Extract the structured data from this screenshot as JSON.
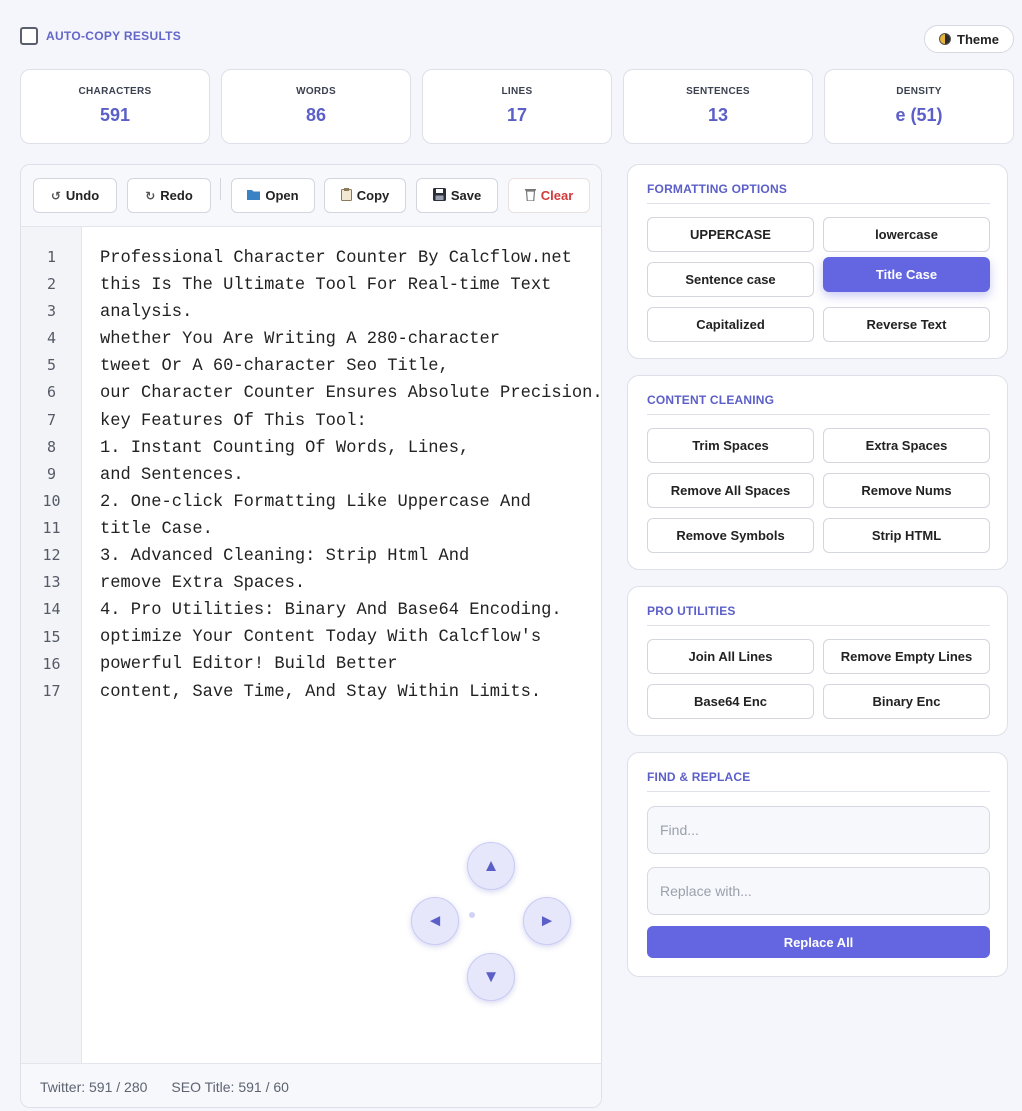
{
  "topbar": {
    "autocopy_label": "AUTO-COPY RESULTS",
    "autocopy_checked": false,
    "theme_label": "Theme"
  },
  "stats": [
    {
      "label": "CHARACTERS",
      "value": "591"
    },
    {
      "label": "WORDS",
      "value": "86"
    },
    {
      "label": "LINES",
      "value": "17"
    },
    {
      "label": "SENTENCES",
      "value": "13"
    },
    {
      "label": "DENSITY",
      "value": "e (51)"
    }
  ],
  "toolbar": {
    "undo": "Undo",
    "redo": "Redo",
    "open": "Open",
    "copy": "Copy",
    "save": "Save",
    "clear": "Clear"
  },
  "editor": {
    "line_numbers": [
      "1",
      "2",
      "3",
      "4",
      "5",
      "6",
      "7",
      "8",
      "9",
      "10",
      "11",
      "12",
      "13",
      "14",
      "15",
      "16",
      "17"
    ],
    "lines": [
      "Professional Character Counter By Calcflow.net",
      "this Is The Ultimate Tool For Real-time Text",
      "analysis.",
      "whether You Are Writing A 280-character",
      "tweet Or A 60-character Seo Title,",
      "our Character Counter Ensures Absolute Precision.",
      "key Features Of This Tool:",
      "1. Instant Counting Of Words, Lines,",
      "and Sentences.",
      "2. One-click Formatting Like Uppercase And",
      "title Case.",
      "3. Advanced Cleaning: Strip Html And",
      "remove Extra Spaces.",
      "4. Pro Utilities: Binary And Base64 Encoding.",
      "optimize Your Content Today With Calcflow's",
      "powerful Editor! Build Better",
      "content, Save Time, And Stay Within Limits."
    ]
  },
  "footer": {
    "twitter": "Twitter: 591 / 280",
    "seo": "SEO Title: 591 / 60"
  },
  "formatting": {
    "title": "FORMATTING OPTIONS",
    "buttons": [
      "UPPERCASE",
      "lowercase",
      "Sentence case",
      "Title Case",
      "Capitalized",
      "Reverse Text"
    ],
    "active": "Title Case"
  },
  "cleaning": {
    "title": "CONTENT CLEANING",
    "buttons": [
      "Trim Spaces",
      "Extra Spaces",
      "Remove All Spaces",
      "Remove Nums",
      "Remove Symbols",
      "Strip HTML"
    ]
  },
  "pro": {
    "title": "PRO UTILITIES",
    "buttons": [
      "Join All Lines",
      "Remove Empty Lines",
      "Base64 Enc",
      "Binary Enc"
    ]
  },
  "find_replace": {
    "title": "FIND & REPLACE",
    "find_placeholder": "Find...",
    "replace_placeholder": "Replace with...",
    "replace_all": "Replace All"
  },
  "colors": {
    "accent": "#6366e0",
    "stat_value": "#5b5fc7",
    "clear": "#d23b3b"
  },
  "icons": {
    "theme": "half-moon-icon",
    "undo": "undo-icon",
    "redo": "redo-icon",
    "open": "folder-icon",
    "copy": "clipboard-icon",
    "save": "floppy-disk-icon",
    "clear": "trash-icon",
    "dpad": [
      "arrow-up-icon",
      "arrow-left-icon",
      "arrow-right-icon",
      "arrow-down-icon"
    ]
  }
}
